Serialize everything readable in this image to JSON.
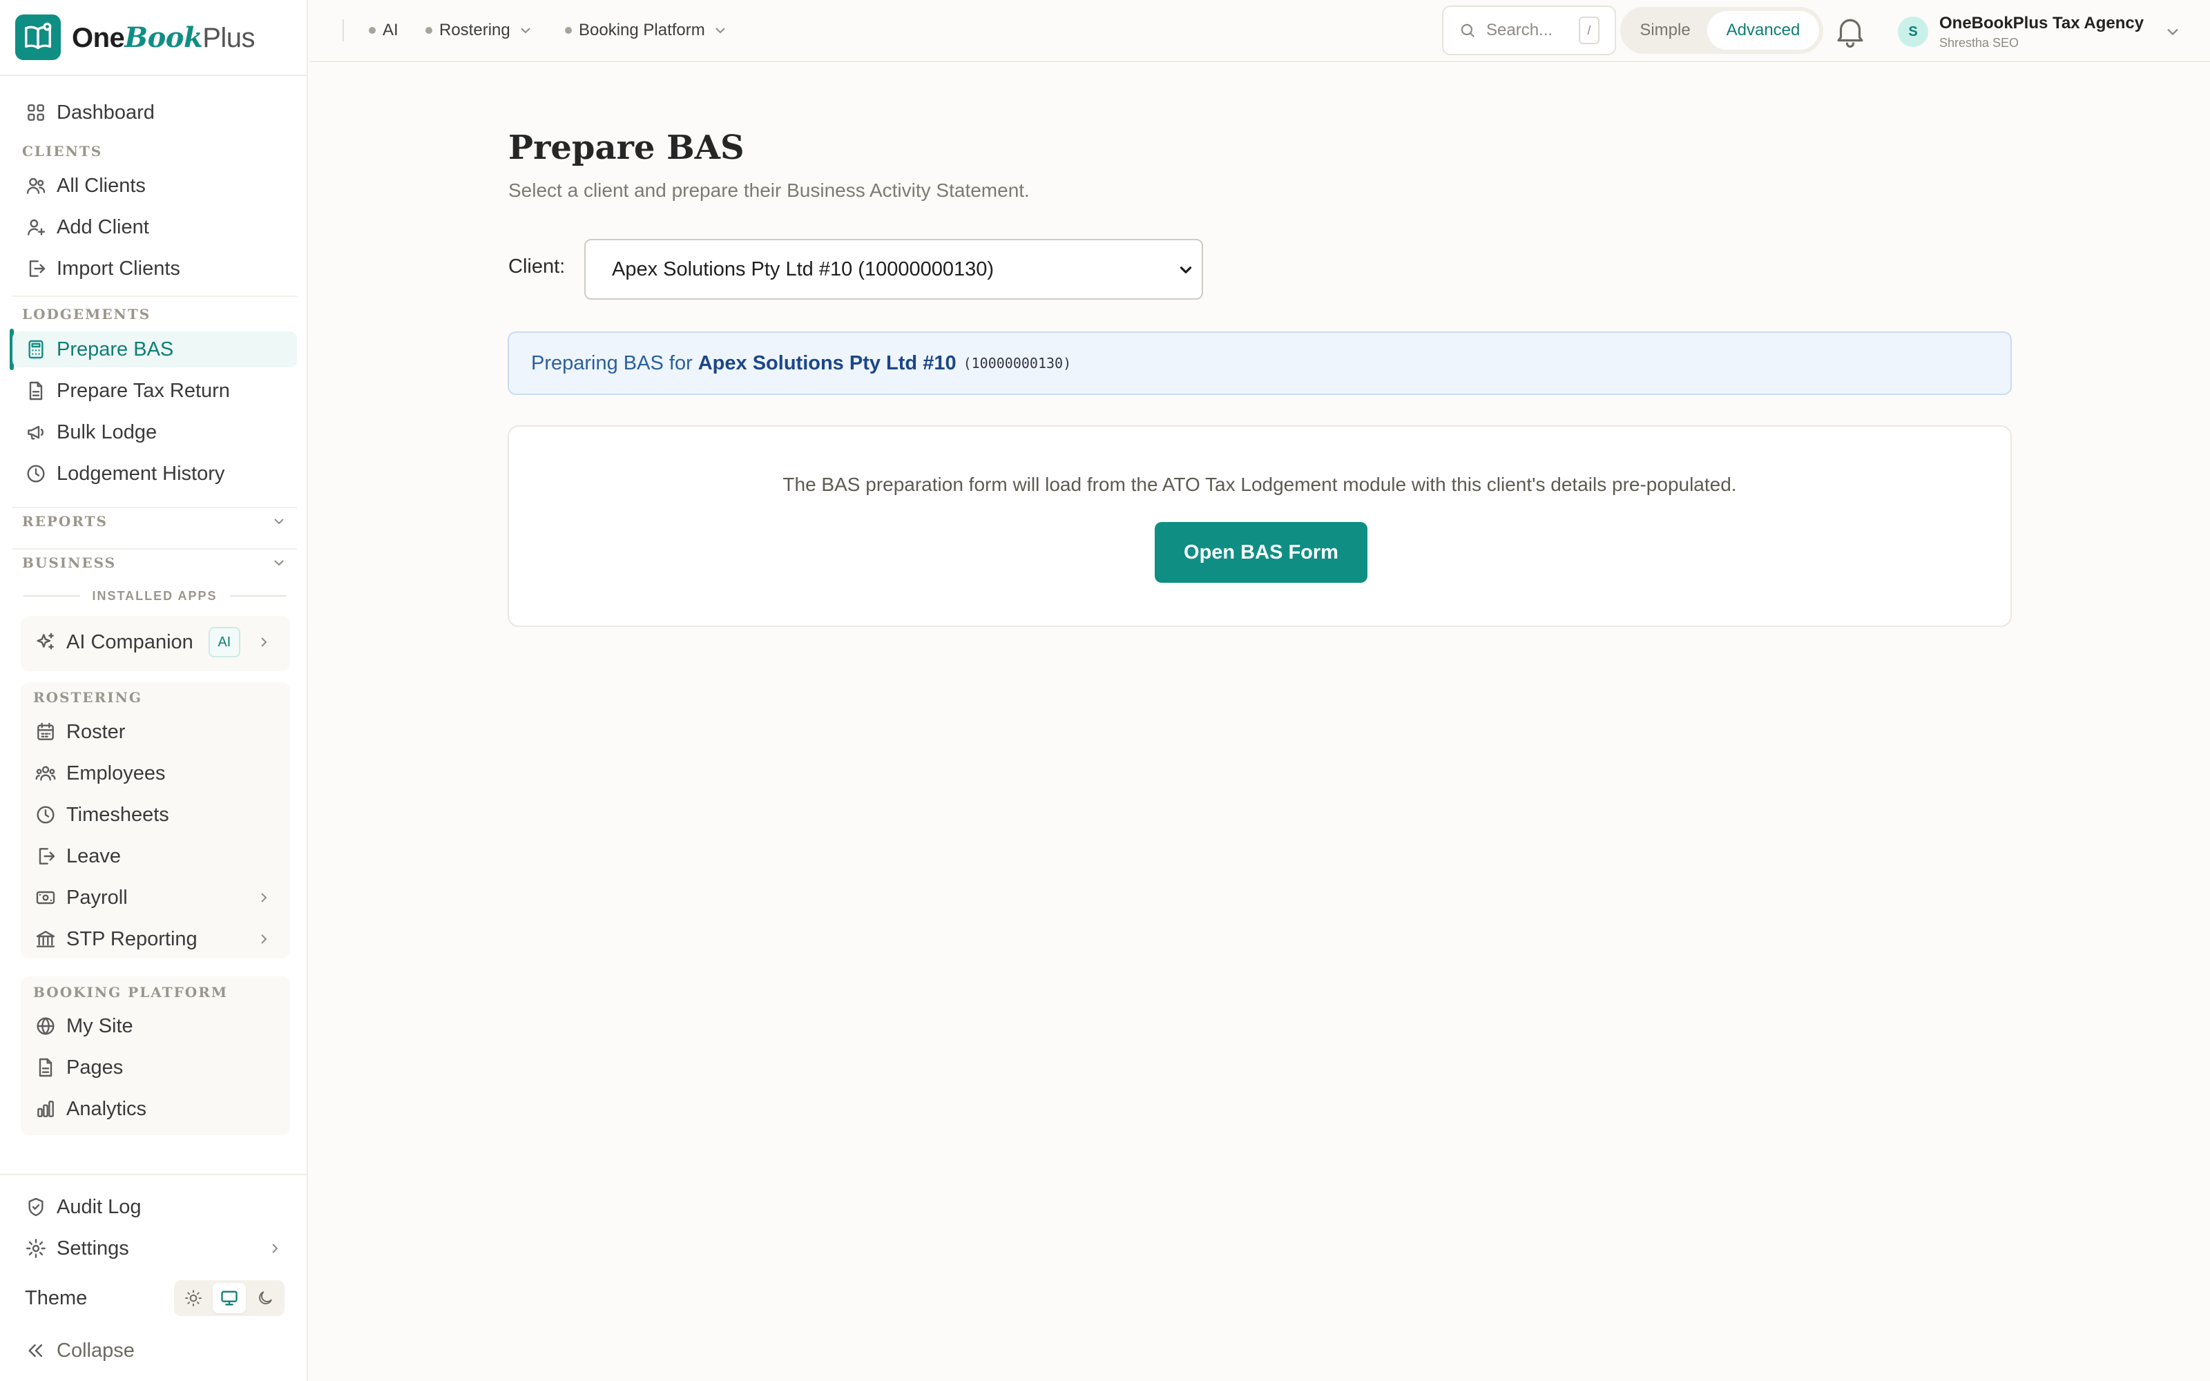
{
  "brand": {
    "part1": "One",
    "part2": "Book",
    "part3": "Plus"
  },
  "sidebar": {
    "dashboard": "Dashboard",
    "clients_label": "CLIENTS",
    "all_clients": "All Clients",
    "add_client": "Add Client",
    "import_clients": "Import Clients",
    "lodgements_label": "LODGEMENTS",
    "prepare_bas": "Prepare BAS",
    "prepare_tax_return": "Prepare Tax Return",
    "bulk_lodge": "Bulk Lodge",
    "lodgement_history": "Lodgement History",
    "reports_label": "REPORTS",
    "business_label": "BUSINESS",
    "installed_apps": "INSTALLED APPS",
    "ai_companion": "AI Companion",
    "ai_badge": "AI",
    "rostering_label": "ROSTERING",
    "roster": "Roster",
    "employees": "Employees",
    "timesheets": "Timesheets",
    "leave": "Leave",
    "payroll": "Payroll",
    "stp_reporting": "STP Reporting",
    "booking_label": "BOOKING PLATFORM",
    "my_site": "My Site",
    "pages": "Pages",
    "analytics": "Analytics",
    "audit_log": "Audit Log",
    "settings": "Settings",
    "theme": "Theme",
    "collapse": "Collapse"
  },
  "topbar": {
    "menu_ai": "AI",
    "menu_rostering": "Rostering",
    "menu_booking": "Booking Platform",
    "search_placeholder": "Search...",
    "search_shortcut": "/",
    "mode_simple": "Simple",
    "mode_advanced": "Advanced",
    "account_initial": "S",
    "account_name": "OneBookPlus Tax Agency",
    "account_sub": "Shrestha SEO"
  },
  "main": {
    "title": "Prepare BAS",
    "subtitle": "Select a client and prepare their Business Activity Statement.",
    "client_label": "Client:",
    "client_selected": "Apex Solutions Pty Ltd #10 (10000000130)",
    "banner_prefix": "Preparing BAS for",
    "banner_client": "Apex Solutions Pty Ltd #10",
    "banner_abn": "(10000000130)",
    "card_text": "The BAS preparation form will load from the ATO Tax Lodgement module with this client's details pre-populated.",
    "open_button": "Open BAS Form"
  },
  "colors": {
    "accent": "#0f8e84",
    "banner_bg": "#eef5fd",
    "banner_text": "#1c468a"
  }
}
